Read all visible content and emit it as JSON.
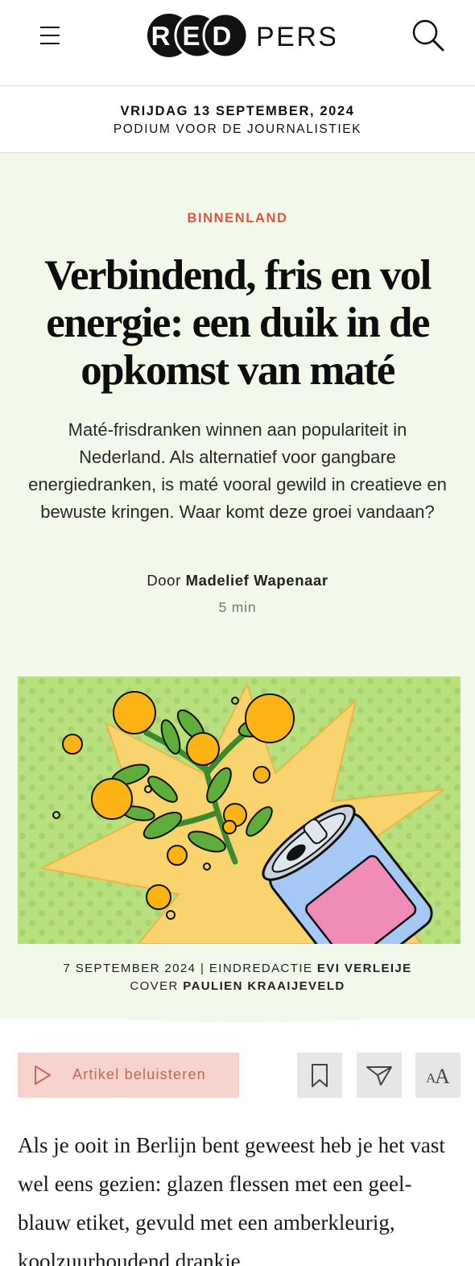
{
  "header": {
    "menu_icon": "hamburger-menu-icon",
    "logo_part_1": "RED",
    "logo_part_2": "PERS",
    "search_icon": "search-icon"
  },
  "dateband": {
    "date": "VRIJDAG 13 SEPTEMBER, 2024",
    "tagline": "PODIUM VOOR DE JOURNALISTIEK"
  },
  "article": {
    "category": "BINNENLAND",
    "title": "Verbindend, fris en vol energie: een duik in de opkomst van maté",
    "lead": "Maté-frisdranken winnen aan populariteit in Nederland. Als alternatief voor gangbare energiedranken, is maté vooral gewild in creatieve en bewuste kringen. Waar komt deze groei vandaan?",
    "byline_prefix": "Door",
    "author": "Madelief Wapenaar",
    "read_time": "5 min",
    "cover_description_icon": "illustration-mate-can-with-plant",
    "credits": {
      "date": "7 SEPTEMBER 2024",
      "separator": "|",
      "editor_label": "EINDREDACTIE",
      "editor": "EVI VERLEIJE",
      "cover_label": "COVER",
      "cover_artist": "PAULIEN KRAAIJEVELD"
    },
    "body_first_paragraph": "Als je ooit in Berlijn bent geweest heb je het vast wel eens gezien: glazen flessen met een geel-blauw etiket, gevuld met een amberkleurig, koolzuurhoudend drankje"
  },
  "toolbar": {
    "listen_label": "Artikel beluisteren",
    "listen_icon": "play-icon",
    "bookmark_icon": "bookmark-icon",
    "share_icon": "share-icon",
    "font_icon": "font-size-icon"
  },
  "colors": {
    "accent": "#e5523c",
    "hero_bg": "#f3f9ea",
    "listen_bg": "#f6d4cd",
    "tool_bg": "#e6e6e6"
  }
}
